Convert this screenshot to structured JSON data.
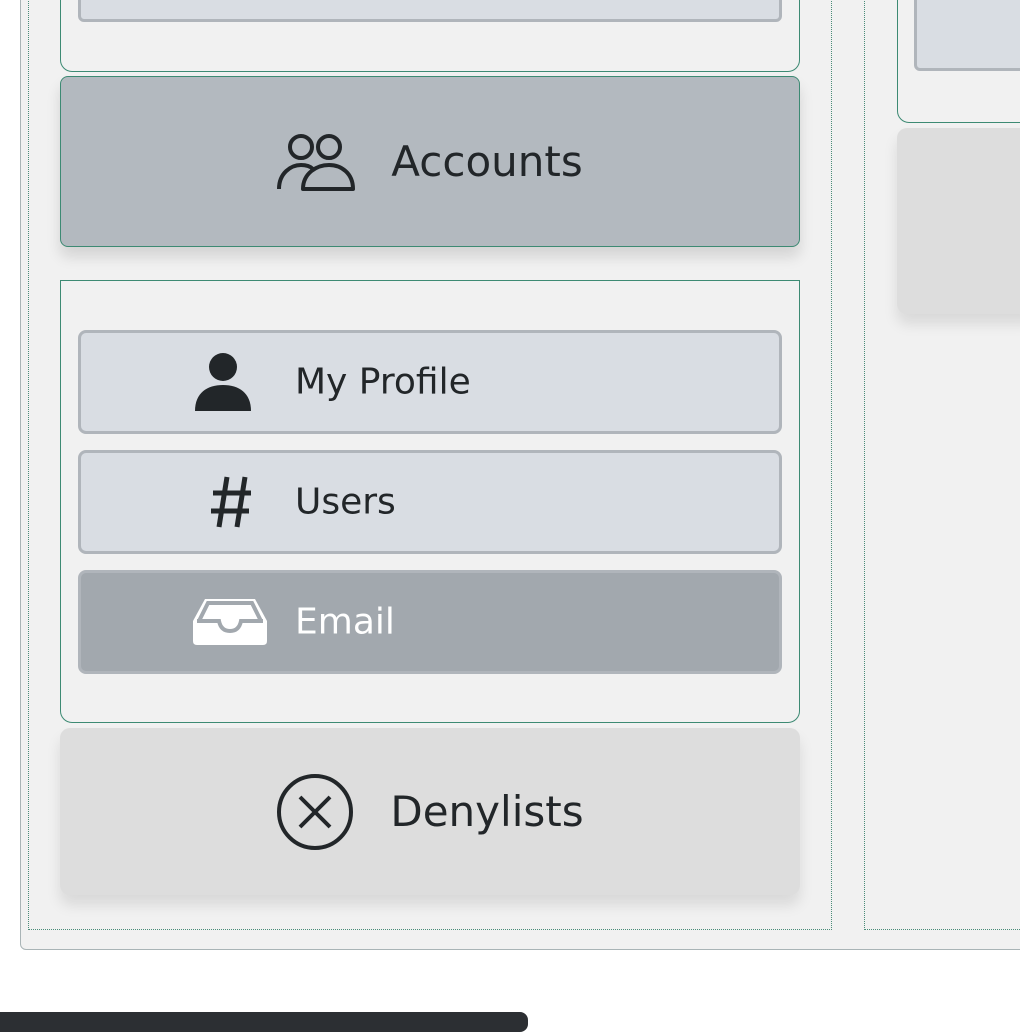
{
  "sidebar": {
    "accounts": {
      "label": "Accounts",
      "icon": "users-icon"
    },
    "accounts_submenu": [
      {
        "label": "My Profile",
        "icon": "user-icon"
      },
      {
        "label": "Users",
        "icon": "hash-icon"
      },
      {
        "label": "Email",
        "icon": "inbox-icon",
        "active": true
      }
    ],
    "denylists": {
      "label": "Denylists",
      "icon": "circle-x-icon"
    }
  },
  "colors": {
    "border_accent": "#3d8a73",
    "selected_bg": "#b3b9bf",
    "active_item_bg": "#a2a8ae",
    "item_bg": "#d9dde3"
  }
}
